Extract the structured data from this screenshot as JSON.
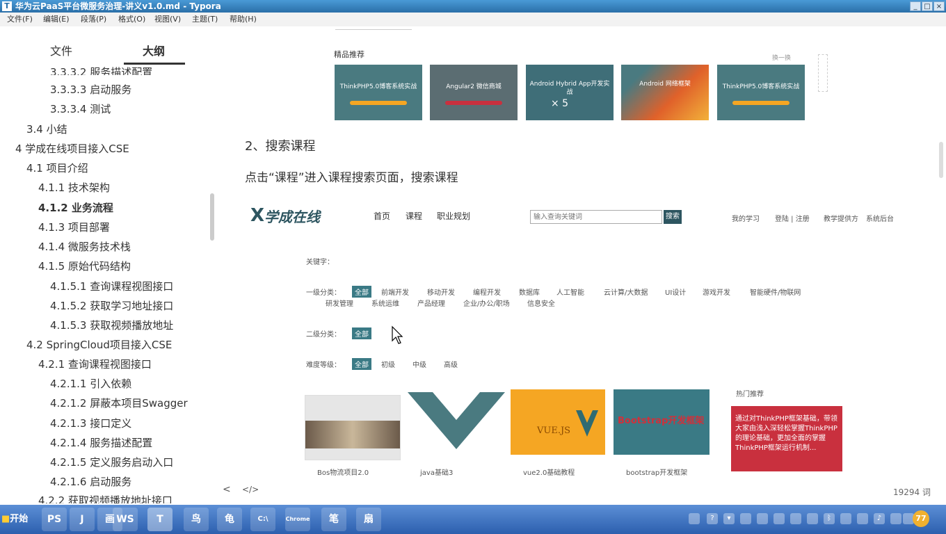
{
  "window": {
    "title": "华为云PaaS平台微服务治理-讲义v1.0.md - Typora"
  },
  "menubar": {
    "items": [
      "文件(F)",
      "编辑(E)",
      "段落(P)",
      "格式(O)",
      "视图(V)",
      "主题(T)",
      "帮助(H)"
    ]
  },
  "sidebar": {
    "tabs": {
      "files": "文件",
      "outline": "大纲"
    },
    "outline": [
      "3.3.3.2 服务描述配置",
      "3.3.3.3 启动服务",
      "3.3.3.4 测试",
      "3.4 小结",
      "4 学成在线项目接入CSE",
      "4.1 项目介绍",
      "4.1.1 技术架构",
      "4.1.2 业务流程",
      "4.1.3 项目部署",
      "4.1.4 微服务技术栈",
      "4.1.5 原始代码结构",
      "4.1.5.1 查询课程视图接口",
      "4.1.5.2 获取学习地址接口",
      "4.1.5.3 获取视频播放地址",
      "4.2 SpringCloud项目接入CSE",
      "4.2.1 查询课程视图接口",
      "4.2.1.1 引入依赖",
      "4.2.1.2 屏蔽本项目Swagger",
      "4.2.1.3 接口定义",
      "4.2.1.4 服务描述配置",
      "4.2.1.5 定义服务启动入口",
      "4.2.1.6 启动服务",
      "4.2.2 获取视频播放地址接口"
    ]
  },
  "main": {
    "recommend": {
      "label": "精品推荐",
      "more": "换一换",
      "cards": [
        "ThinkPHP5.0博客系统实战",
        "Angular2 微信商城",
        "Android Hybrid App开发实战",
        "Android 网络框架",
        "ThinkPHP5.0博客系统实战"
      ],
      "card_sub": "× 5"
    },
    "heading": "2、搜索课程",
    "paragraph": "点击“课程”进入课程搜索页面，搜索课程",
    "site": {
      "logo": "学成在线",
      "nav": [
        "首页",
        "课程",
        "职业规划"
      ],
      "search_placeholder": "输入查询关键词",
      "search_button": "搜索",
      "right_links": [
        "我的学习",
        "登陆 | 注册",
        "教学提供方",
        "系统后台"
      ],
      "filters": {
        "keyword_label": "关键字：",
        "level1_label": "一级分类：",
        "level1_row1": [
          "全部",
          "前端开发",
          "移动开发",
          "编程开发",
          "数据库",
          "人工智能",
          "云计算/大数据",
          "UI设计",
          "游戏开发",
          "智能硬件/物联网"
        ],
        "level1_row2": [
          "研发管理",
          "系统运维",
          "产品经理",
          "企业/办公/职场",
          "信息安全"
        ],
        "level2_label": "二级分类：",
        "level2": [
          "全部"
        ],
        "difficulty_label": "难度等级：",
        "difficulty": [
          "全部",
          "初级",
          "中级",
          "高级"
        ]
      },
      "courses": [
        {
          "title": "Bos物流项目2.0",
          "color": "#e8e8e8"
        },
        {
          "title": "java基础3",
          "color": "#ffffff"
        },
        {
          "title": "vue2.0基础教程",
          "color": "#f5a623"
        },
        {
          "title": "bootstrap开发框架",
          "color": "#3a7a85"
        }
      ],
      "course_art": {
        "vue": "VUE.JS",
        "bootstrap": "Bootstrap开发框架"
      },
      "hot": {
        "label": "热门推荐",
        "text": "通过对ThinkPHP框架基础，带领大家由浅入深轻松掌握ThinkPHP的理论基础，更加全面的掌握ThinkPHP框架运行机制..."
      }
    }
  },
  "statusbar": {
    "back": "<",
    "source": "</>",
    "wordcount": "19294 词"
  },
  "taskbar": {
    "start": "开始",
    "apps": [
      "PS",
      "J",
      "画",
      "WS",
      "T",
      "鸟",
      "龟",
      "C:\\",
      "Chrome",
      "笔",
      "扇"
    ],
    "clock": "77"
  },
  "colors": {
    "accent": "#3a7a85",
    "orange": "#f5a623",
    "hot_red": "#c9303e"
  }
}
